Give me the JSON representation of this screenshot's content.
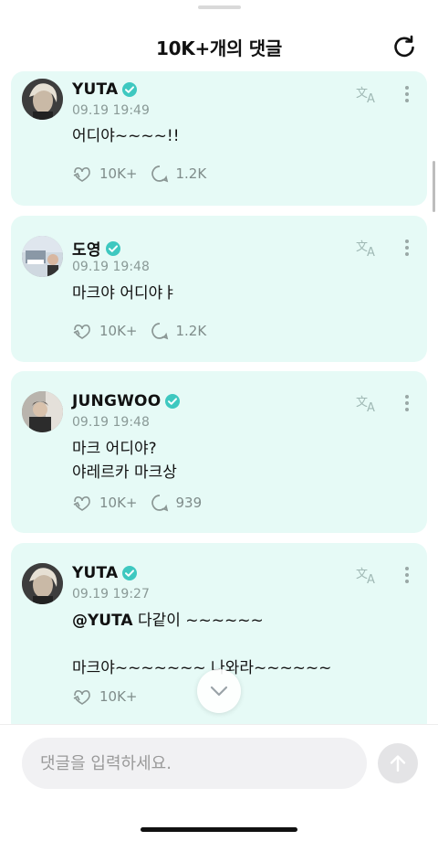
{
  "header": {
    "title": "10K+개의 댓글",
    "refresh_icon": "refresh-icon"
  },
  "comments": [
    {
      "author": "YUTA",
      "verified": true,
      "time": "09.19 19:49",
      "text": "어디야~~~~!!",
      "likes": "10K+",
      "replies": "1.2K"
    },
    {
      "author": "도영",
      "verified": true,
      "time": "09.19 19:48",
      "text": "마크야 어디야ㅑ",
      "likes": "10K+",
      "replies": "1.2K"
    },
    {
      "author": "JUNGWOO",
      "verified": true,
      "time": "09.19 19:48",
      "text": "마크 어디야?\n야레르카 마크상",
      "likes": "10K+",
      "replies": "939"
    },
    {
      "author": "YUTA",
      "verified": true,
      "time": "09.19 19:27",
      "mention": "@YUTA",
      "text_after_mention": " 다같이 ~~~~~~\n\n마크야~~~~~~~ 나와라~~~~~~",
      "likes": "10K+"
    }
  ],
  "composer": {
    "placeholder": "댓글을 입력하세요.",
    "value": ""
  },
  "colors": {
    "card_bg": "#e6faf6",
    "accent": "#3ec8c0"
  }
}
